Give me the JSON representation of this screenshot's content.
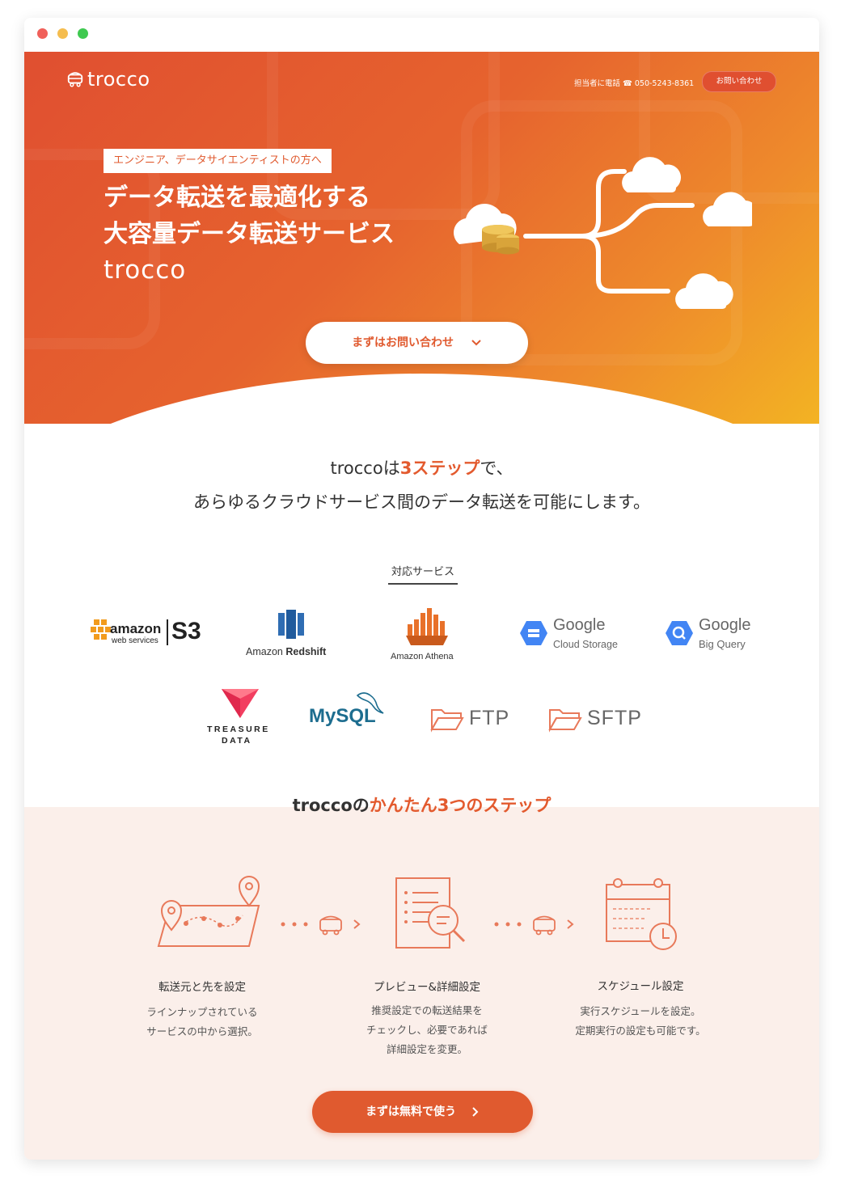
{
  "header": {
    "logo": "trocco",
    "phone": "担当者に電話 ☎ 050-5243-8361",
    "contact_button": "お問い合わせ"
  },
  "hero": {
    "tag": "エンジニア、データサイエンティストの方へ",
    "headline_line1": "データ転送を最適化する",
    "headline_line2": "大容量データ転送サービス",
    "headline_brand": "trocco",
    "cta": "まずはお問い合わせ",
    "cta_icon": "chevron-down-icon"
  },
  "intro": {
    "line1_prefix": "troccoは",
    "line1_highlight": "3ステップ",
    "line1_suffix": "で、",
    "line2": "あらゆるクラウドサービス間のデータ転送を可能にします。"
  },
  "services": {
    "label": "対応サービス",
    "items": [
      {
        "name": "Amazon S3",
        "text1": "amazon",
        "text2": "web services",
        "text3": "S3"
      },
      {
        "name": "Amazon Redshift",
        "text1": "Amazon",
        "text2": "Redshift"
      },
      {
        "name": "Amazon Athena",
        "text1": "Amazon Athena"
      },
      {
        "name": "Google Cloud Storage",
        "text1": "Google",
        "text2": "Cloud Storage"
      },
      {
        "name": "Google Big Query",
        "text1": "Google",
        "text2": "Big Query"
      },
      {
        "name": "Treasure Data",
        "text1": "TREASURE",
        "text2": "DATA"
      },
      {
        "name": "MySQL",
        "text1": "MySQL"
      },
      {
        "name": "FTP",
        "text1": "FTP"
      },
      {
        "name": "SFTP",
        "text1": "SFTP"
      }
    ]
  },
  "steps": {
    "title_prefix": "troccoの",
    "title_highlight": "かんたん3つのステップ",
    "items": [
      {
        "title": "転送元と先を設定",
        "desc": [
          "ラインナップされている",
          "サービスの中から選択。"
        ]
      },
      {
        "title": "プレビュー&詳細設定",
        "desc": [
          "推奨設定での転送結果を",
          "チェックし、必要であれば",
          "詳細設定を変更。"
        ]
      },
      {
        "title": "スケジュール設定",
        "desc": [
          "実行スケジュールを設定。",
          "定期実行の設定も可能です。"
        ]
      }
    ],
    "cta": "まずは無料で使う",
    "cta_icon": "chevron-right-icon"
  },
  "colors": {
    "accent": "#e05a2f",
    "hero_gradient_start": "#e04f30",
    "hero_gradient_end": "#f3b323",
    "steps_background": "#fbefea"
  }
}
